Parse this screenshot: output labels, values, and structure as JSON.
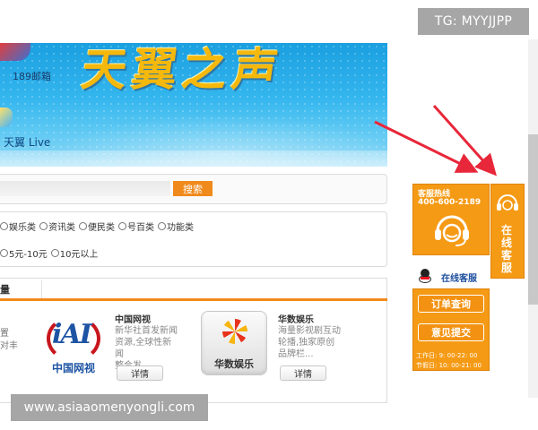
{
  "watermarks": {
    "top": "TG: MYYJJPP",
    "bottom": "www.asiaaomenyongli.com"
  },
  "banner": {
    "title_main": "天翼之声",
    "mail_label": "189邮箱",
    "live_label": "天翼 Live"
  },
  "search": {
    "button_label": "搜索",
    "input_value": ""
  },
  "filters": {
    "row1": [
      "娱乐类",
      "资讯类",
      "便民类",
      "号百类",
      "功能类"
    ],
    "row2": [
      "5元-10元",
      "10元以上"
    ]
  },
  "apps_section": {
    "tab_label": "量",
    "left_desc": [
      "置",
      "对丰"
    ],
    "items": [
      {
        "logo_mark": "iAI",
        "logo_name": "中国网视",
        "name": "中国网视",
        "description": [
          "新华社首发新闻",
          "资源,全球性新闻",
          "整合发..."
        ],
        "button_label": "详情"
      },
      {
        "logo_name": "华数娱乐",
        "name": "华数娱乐",
        "description": [
          "海量影视剧互动",
          "轮播,独家原创",
          "品牌栏..."
        ],
        "button_label": "详情"
      }
    ]
  },
  "customer_service": {
    "hotline_title": "客服热线",
    "hotline_number": "400-600-2189",
    "side_tab_label": "在线客服",
    "qq_label": "在线客服",
    "buttons": [
      "订单查询",
      "意见提交"
    ],
    "hours": [
      "工作日: 9: 00-22: 00",
      "节假日: 10: 00-21: 00"
    ],
    "icons": [
      "headset-icon",
      "qq-icon"
    ]
  },
  "colors": {
    "accent": "#f59a14",
    "search_button": "#f08a1c",
    "arrow": "#e8273a",
    "banner_blue": "#34b6ee",
    "title_gold": "#f5b80c"
  }
}
